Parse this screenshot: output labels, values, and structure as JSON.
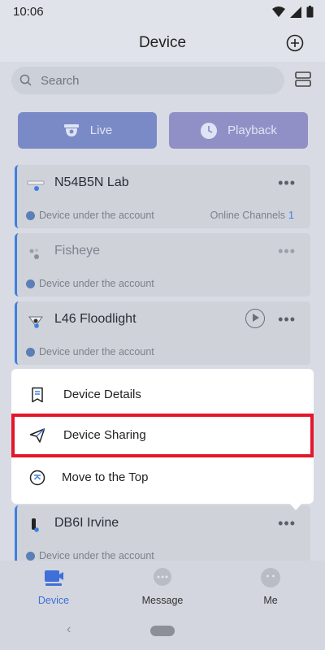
{
  "status": {
    "time": "10:06"
  },
  "header": {
    "title": "Device"
  },
  "search": {
    "placeholder": "Search"
  },
  "modes": {
    "live": "Live",
    "playback": "Playback"
  },
  "devices": [
    {
      "name": "N54B5N Lab",
      "account": "Device under the account",
      "online_label": "Online Channels",
      "online_count": "1"
    },
    {
      "name": "Fisheye",
      "account": "Device under the account"
    },
    {
      "name": "L46 Floodlight",
      "account": "Device under the account"
    },
    {
      "name": "DB6I Irvine",
      "account": "Device under the account"
    }
  ],
  "menu": {
    "items": [
      {
        "label": "Device Details",
        "icon": "document-icon"
      },
      {
        "label": "Device Sharing",
        "icon": "paper-plane-icon"
      },
      {
        "label": "Move to the Top",
        "icon": "move-top-icon"
      }
    ]
  },
  "tabs": [
    {
      "label": "Device",
      "icon": "camera-icon",
      "active": true
    },
    {
      "label": "Message",
      "icon": "chat-icon",
      "active": false
    },
    {
      "label": "Me",
      "icon": "profile-icon",
      "active": false
    }
  ],
  "colors": {
    "accent": "#3f7fe0",
    "highlight": "#e4162b",
    "live": "#7a8ac6",
    "playback": "#9190c6"
  }
}
